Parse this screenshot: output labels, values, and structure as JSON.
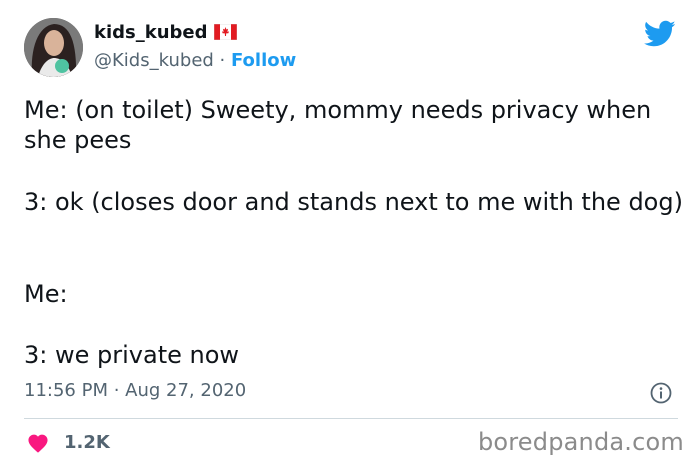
{
  "author": {
    "name": "kids_kubed",
    "handle": "@Kids_kubed",
    "separator": " · ",
    "follow_label": "Follow"
  },
  "tweet": {
    "line1": "Me: (on toilet) Sweety, mommy needs privacy when she pees",
    "line2": "3: ok (closes door and stands next to me with the dog)",
    "line3": "Me:",
    "line4": "3: we private now",
    "time": "11:56 PM",
    "dot": " · ",
    "date": "Aug 27, 2020"
  },
  "engagement": {
    "likes": "1.2K"
  },
  "watermark": "boredpanda.com",
  "colors": {
    "accent": "#1d9bf0",
    "heart": "#f91880",
    "secondary": "#536471"
  },
  "icons": [
    "avatar",
    "canada-flag-icon",
    "twitter-bird-icon",
    "info-icon",
    "heart-icon"
  ]
}
